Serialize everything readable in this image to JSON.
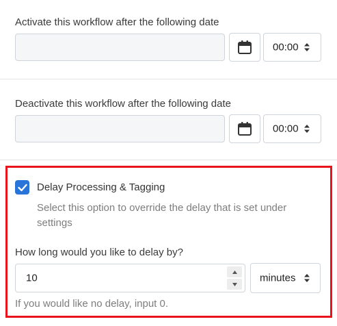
{
  "activate": {
    "label": "Activate this workflow after the following date",
    "date_value": "",
    "time_value": "00:00"
  },
  "deactivate": {
    "label": "Deactivate this workflow after the following date",
    "date_value": "",
    "time_value": "00:00"
  },
  "delay": {
    "checkbox_checked": true,
    "checkbox_label": "Delay Processing & Tagging",
    "help_text": "Select this option to override the delay that is set under settings",
    "question_label": "How long would you like to delay by?",
    "amount_value": "10",
    "unit_value": "minutes",
    "bottom_help": "If you would like no delay, input 0."
  },
  "colors": {
    "checkbox": "#2874d8",
    "highlight": "#e8131b",
    "input_bg": "#f4f6f8"
  },
  "icons": {
    "calendar": "calendar-icon",
    "sort": "sort-icon",
    "check": "check-icon",
    "spin_up": "caret-up-icon",
    "spin_down": "caret-down-icon"
  }
}
